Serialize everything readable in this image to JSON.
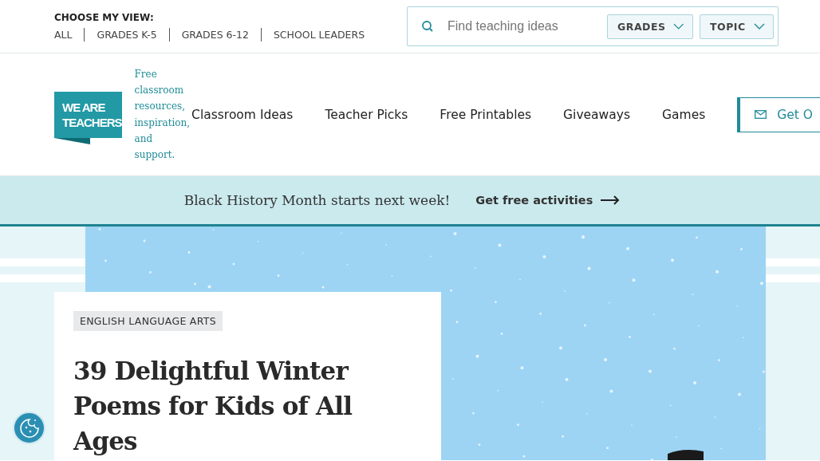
{
  "view_chooser": {
    "label": "CHOOSE MY VIEW:",
    "options": [
      "ALL",
      "GRADES K-5",
      "GRADES 6-12",
      "SCHOOL LEADERS"
    ]
  },
  "search": {
    "placeholder": "Find teaching ideas",
    "filters": [
      "GRADES",
      "TOPIC"
    ]
  },
  "logo": {
    "line1": "WE ARE",
    "line2": "TEACHERS"
  },
  "tagline": "Free classroom resources, inspiration, and support.",
  "nav": [
    "Classroom Ideas",
    "Teacher Picks",
    "Free Printables",
    "Giveaways",
    "Games"
  ],
  "newsletter_button": "Get O",
  "banner": {
    "text": "Black History Month starts next week!",
    "link": "Get free activities"
  },
  "article": {
    "category": "ENGLISH LANGUAGE ARTS",
    "title": "39 Delightful Winter Poems for Kids of All Ages"
  }
}
